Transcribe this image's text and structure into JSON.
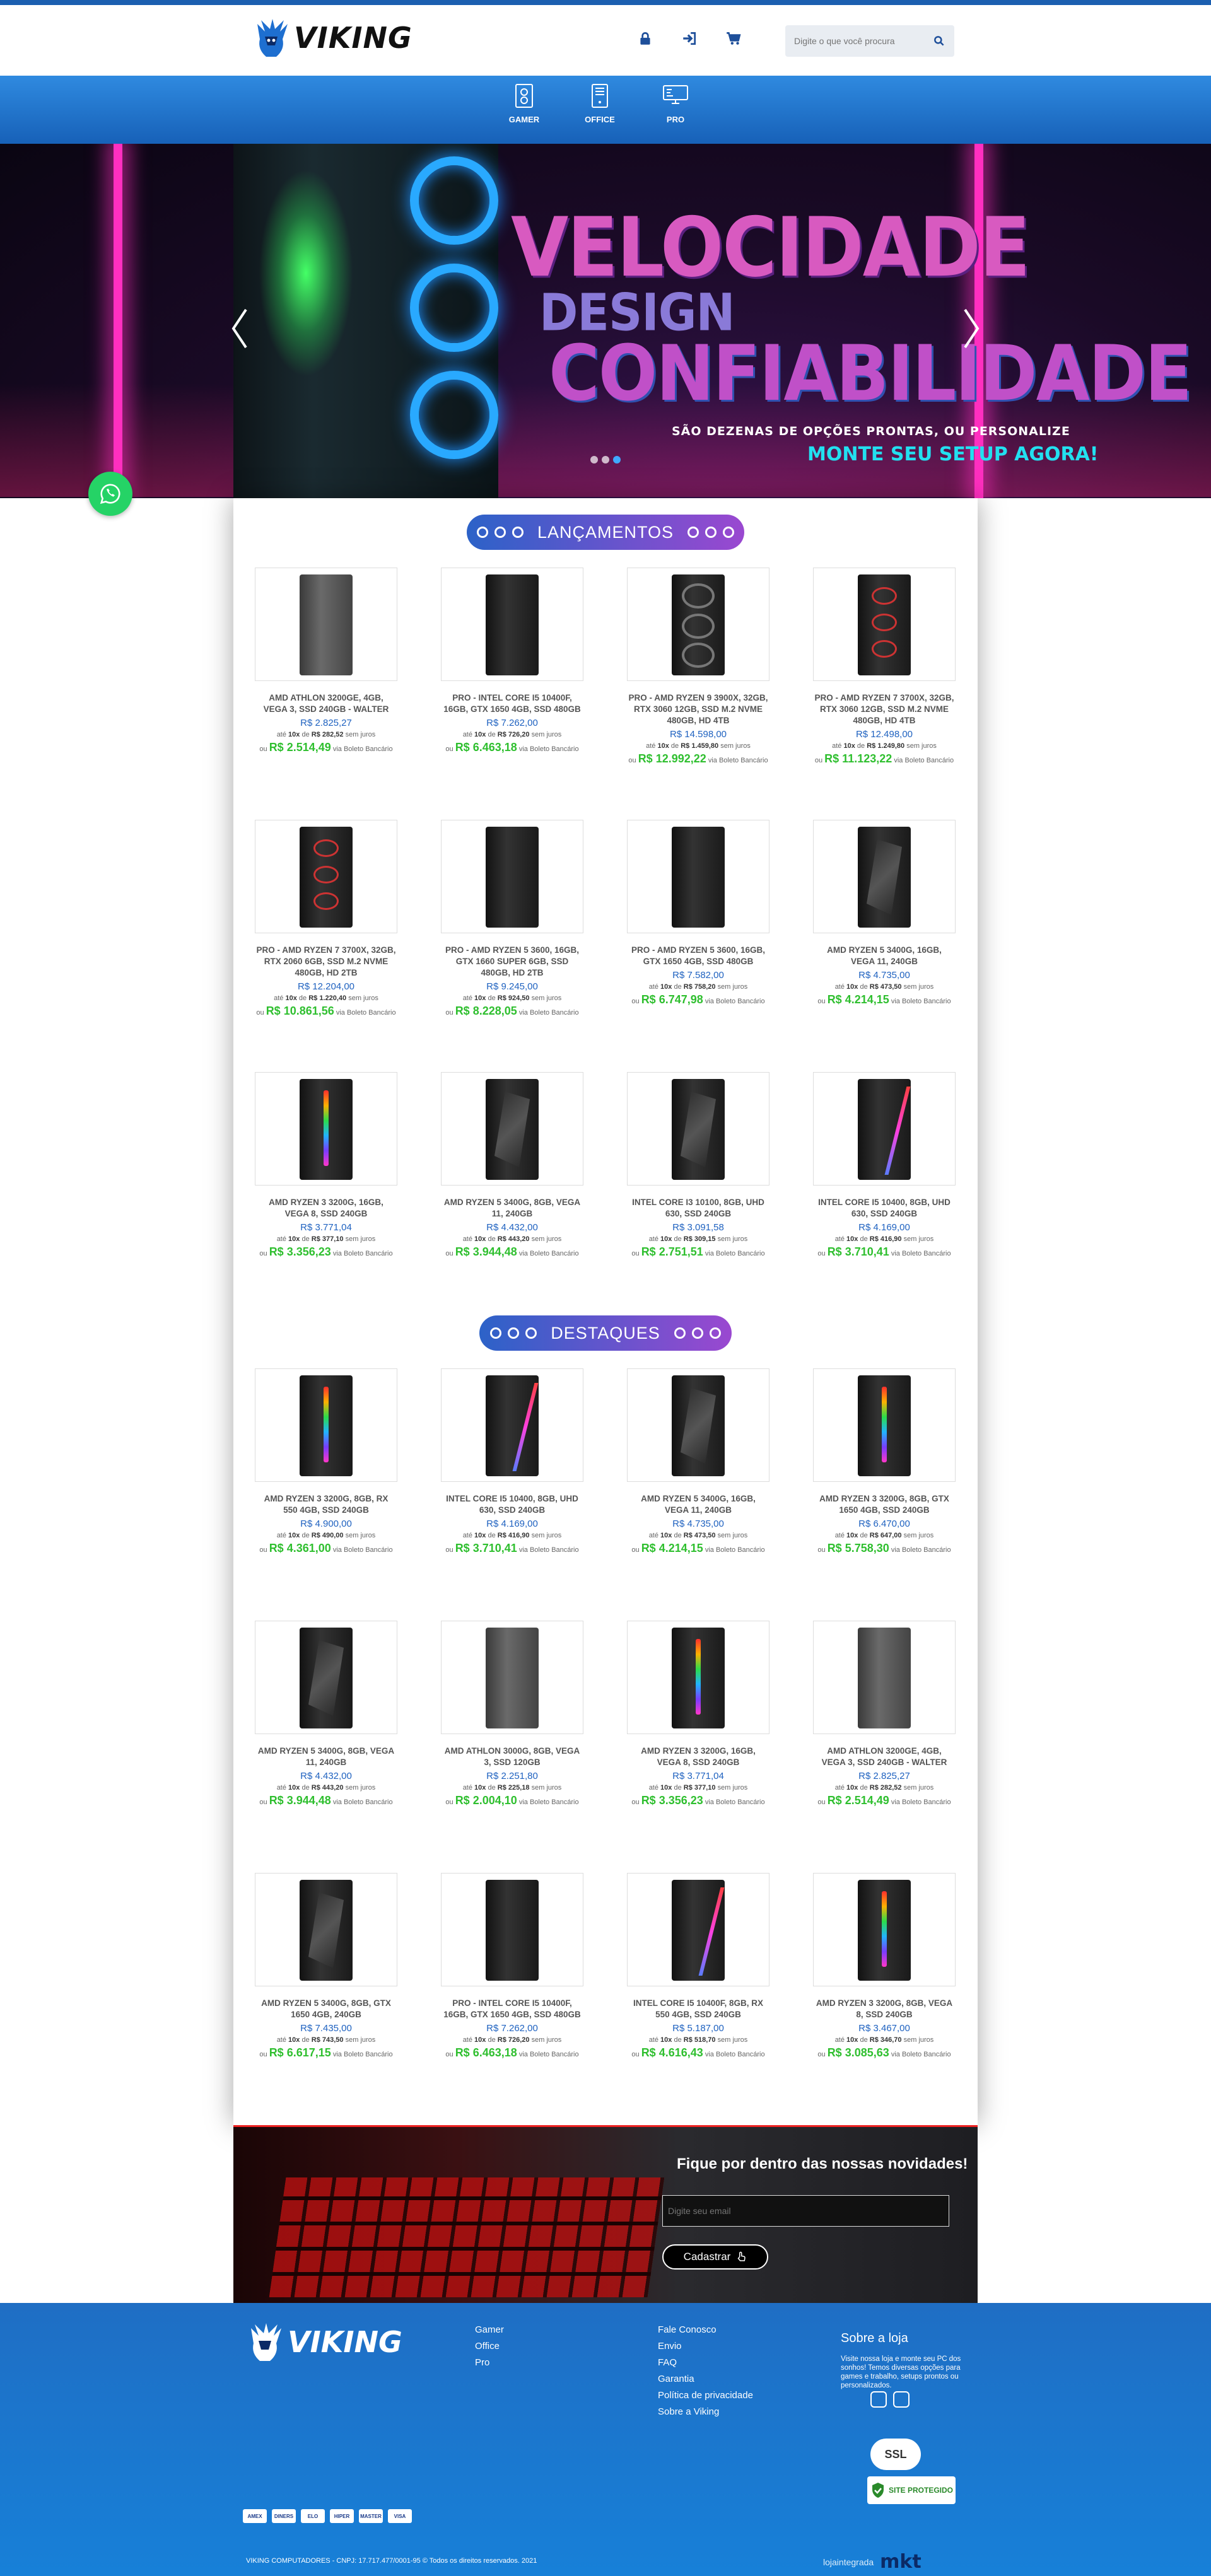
{
  "header": {
    "brand": "VIKING",
    "search_placeholder": "Digite o que você procura"
  },
  "nav": {
    "items": [
      {
        "label": "GAMER"
      },
      {
        "label": "OFFICE"
      },
      {
        "label": "PRO"
      }
    ]
  },
  "hero": {
    "line1": "VELOCIDADE",
    "line2": "DESIGN",
    "line3": "CONFIABILIDADE",
    "subtitle": "SÃO DEZENAS DE OPÇÕES PRONTAS, OU PERSONALIZE",
    "cta": "MONTE SEU SETUP AGORA!",
    "slide_count": 3,
    "active_slide": 3
  },
  "sections": {
    "launches_title": "LANÇAMENTOS",
    "highlights_title": "DESTAQUES"
  },
  "labels": {
    "installment_prefix": "até",
    "installment_of": "de",
    "installment_suffix": "sem juros",
    "boleto_prefix": "ou",
    "boleto_suffix": "via Boleto Bancário"
  },
  "launches": [
    {
      "name": "AMD ATHLON 3200GE, 4GB, VEGA 3, SSD 240GB - WALTER",
      "price": "R$ 2.825,27",
      "n": "10x",
      "inst": "R$ 282,52",
      "boleto": "R$ 2.514,49"
    },
    {
      "name": "PRO - INTEL CORE I5 10400F, 16GB, GTX 1650 4GB, SSD 480GB",
      "price": "R$ 7.262,00",
      "n": "10x",
      "inst": "R$ 726,20",
      "boleto": "R$ 6.463,18"
    },
    {
      "name": "PRO - AMD RYZEN 9 3900X, 32GB, RTX 3060 12GB, SSD M.2 NVME 480GB, HD 4TB",
      "price": "R$ 14.598,00",
      "n": "10x",
      "inst": "R$ 1.459,80",
      "boleto": "R$ 12.992,22"
    },
    {
      "name": "PRO - AMD RYZEN 7 3700X, 32GB, RTX 3060 12GB, SSD M.2 NVME 480GB, HD 4TB",
      "price": "R$ 12.498,00",
      "n": "10x",
      "inst": "R$ 1.249,80",
      "boleto": "R$ 11.123,22"
    },
    {
      "name": "PRO - AMD RYZEN 7 3700X, 32GB, RTX 2060 6GB, SSD M.2 NVME 480GB, HD 2TB",
      "price": "R$ 12.204,00",
      "n": "10x",
      "inst": "R$ 1.220,40",
      "boleto": "R$ 10.861,56"
    },
    {
      "name": "PRO - AMD RYZEN 5 3600, 16GB, GTX 1660 SUPER 6GB, SSD 480GB, HD 2TB",
      "price": "R$ 9.245,00",
      "n": "10x",
      "inst": "R$ 924,50",
      "boleto": "R$ 8.228,05"
    },
    {
      "name": "PRO - AMD RYZEN 5 3600, 16GB, GTX 1650 4GB, SSD 480GB",
      "price": "R$ 7.582,00",
      "n": "10x",
      "inst": "R$ 758,20",
      "boleto": "R$ 6.747,98"
    },
    {
      "name": "AMD RYZEN 5 3400G, 16GB, VEGA 11, 240GB",
      "price": "R$ 4.735,00",
      "n": "10x",
      "inst": "R$ 473,50",
      "boleto": "R$ 4.214,15"
    },
    {
      "name": "AMD RYZEN 3 3200G, 16GB, VEGA 8, SSD 240GB",
      "price": "R$ 3.771,04",
      "n": "10x",
      "inst": "R$ 377,10",
      "boleto": "R$ 3.356,23"
    },
    {
      "name": "AMD RYZEN 5 3400G, 8GB, VEGA 11, 240GB",
      "price": "R$ 4.432,00",
      "n": "10x",
      "inst": "R$ 443,20",
      "boleto": "R$ 3.944,48"
    },
    {
      "name": "INTEL CORE I3 10100, 8GB, UHD 630, SSD 240GB",
      "price": "R$ 3.091,58",
      "n": "10x",
      "inst": "R$ 309,15",
      "boleto": "R$ 2.751,51"
    },
    {
      "name": "INTEL CORE I5 10400, 8GB, UHD 630, SSD 240GB",
      "price": "R$ 4.169,00",
      "n": "10x",
      "inst": "R$ 416,90",
      "boleto": "R$ 3.710,41"
    }
  ],
  "highlights": [
    {
      "name": "AMD RYZEN 3 3200G, 8GB, RX 550 4GB, SSD 240GB",
      "price": "R$ 4.900,00",
      "n": "10x",
      "inst": "R$ 490,00",
      "boleto": "R$ 4.361,00"
    },
    {
      "name": "INTEL CORE I5 10400, 8GB, UHD 630, SSD 240GB",
      "price": "R$ 4.169,00",
      "n": "10x",
      "inst": "R$ 416,90",
      "boleto": "R$ 3.710,41"
    },
    {
      "name": "AMD RYZEN 5 3400G, 16GB, VEGA 11, 240GB",
      "price": "R$ 4.735,00",
      "n": "10x",
      "inst": "R$ 473,50",
      "boleto": "R$ 4.214,15"
    },
    {
      "name": "AMD RYZEN 3 3200G, 8GB, GTX 1650 4GB, SSD 240GB",
      "price": "R$ 6.470,00",
      "n": "10x",
      "inst": "R$ 647,00",
      "boleto": "R$ 5.758,30"
    },
    {
      "name": "AMD RYZEN 5 3400G, 8GB, VEGA 11, 240GB",
      "price": "R$ 4.432,00",
      "n": "10x",
      "inst": "R$ 443,20",
      "boleto": "R$ 3.944,48"
    },
    {
      "name": "AMD ATHLON 3000G, 8GB, VEGA 3, SSD 120GB",
      "price": "R$ 2.251,80",
      "n": "10x",
      "inst": "R$ 225,18",
      "boleto": "R$ 2.004,10"
    },
    {
      "name": "AMD RYZEN 3 3200G, 16GB, VEGA 8, SSD 240GB",
      "price": "R$ 3.771,04",
      "n": "10x",
      "inst": "R$ 377,10",
      "boleto": "R$ 3.356,23"
    },
    {
      "name": "AMD ATHLON 3200GE, 4GB, VEGA 3, SSD 240GB - WALTER",
      "price": "R$ 2.825,27",
      "n": "10x",
      "inst": "R$ 282,52",
      "boleto": "R$ 2.514,49"
    },
    {
      "name": "AMD RYZEN 5 3400G, 8GB, GTX 1650 4GB, 240GB",
      "price": "R$ 7.435,00",
      "n": "10x",
      "inst": "R$ 743,50",
      "boleto": "R$ 6.617,15"
    },
    {
      "name": "PRO - INTEL CORE I5 10400F, 16GB, GTX 1650 4GB, SSD 480GB",
      "price": "R$ 7.262,00",
      "n": "10x",
      "inst": "R$ 726,20",
      "boleto": "R$ 6.463,18"
    },
    {
      "name": "INTEL CORE I5 10400F, 8GB, RX 550 4GB, SSD 240GB",
      "price": "R$ 5.187,00",
      "n": "10x",
      "inst": "R$ 518,70",
      "boleto": "R$ 4.616,43"
    },
    {
      "name": "AMD RYZEN 3 3200G, 8GB, VEGA 8, SSD 240GB",
      "price": "R$ 3.467,00",
      "n": "10x",
      "inst": "R$ 346,70",
      "boleto": "R$ 3.085,63"
    }
  ],
  "newsletter": {
    "title": "Fique por dentro das nossas novidades!",
    "placeholder": "Digite seu email",
    "button": "Cadastrar"
  },
  "footer": {
    "brand": "VIKING",
    "col1": [
      "Gamer",
      "Office",
      "Pro"
    ],
    "col2": [
      "Fale Conosco",
      "Envio",
      "FAQ",
      "Garantia",
      "Política de privacidade",
      "Sobre a Viking"
    ],
    "about_title": "Sobre a loja",
    "about_text": "Visite nossa loja e monte seu PC dos sonhos! Temos diversas opções para games e trabalho, setups prontos ou personalizados.",
    "ssl_label": "SSL",
    "safe_label": "SITE PROTEGIDO",
    "payments": [
      "AMEX",
      "DINERS",
      "ELO",
      "HIPER",
      "MASTER",
      "VISA"
    ],
    "copyright": "VIKING COMPUTADORES - CNPJ: 17.717.477/0001-95 © Todos os direitos reservados. 2021",
    "credit1": "lojaintegrada",
    "credit2": "mkt"
  }
}
